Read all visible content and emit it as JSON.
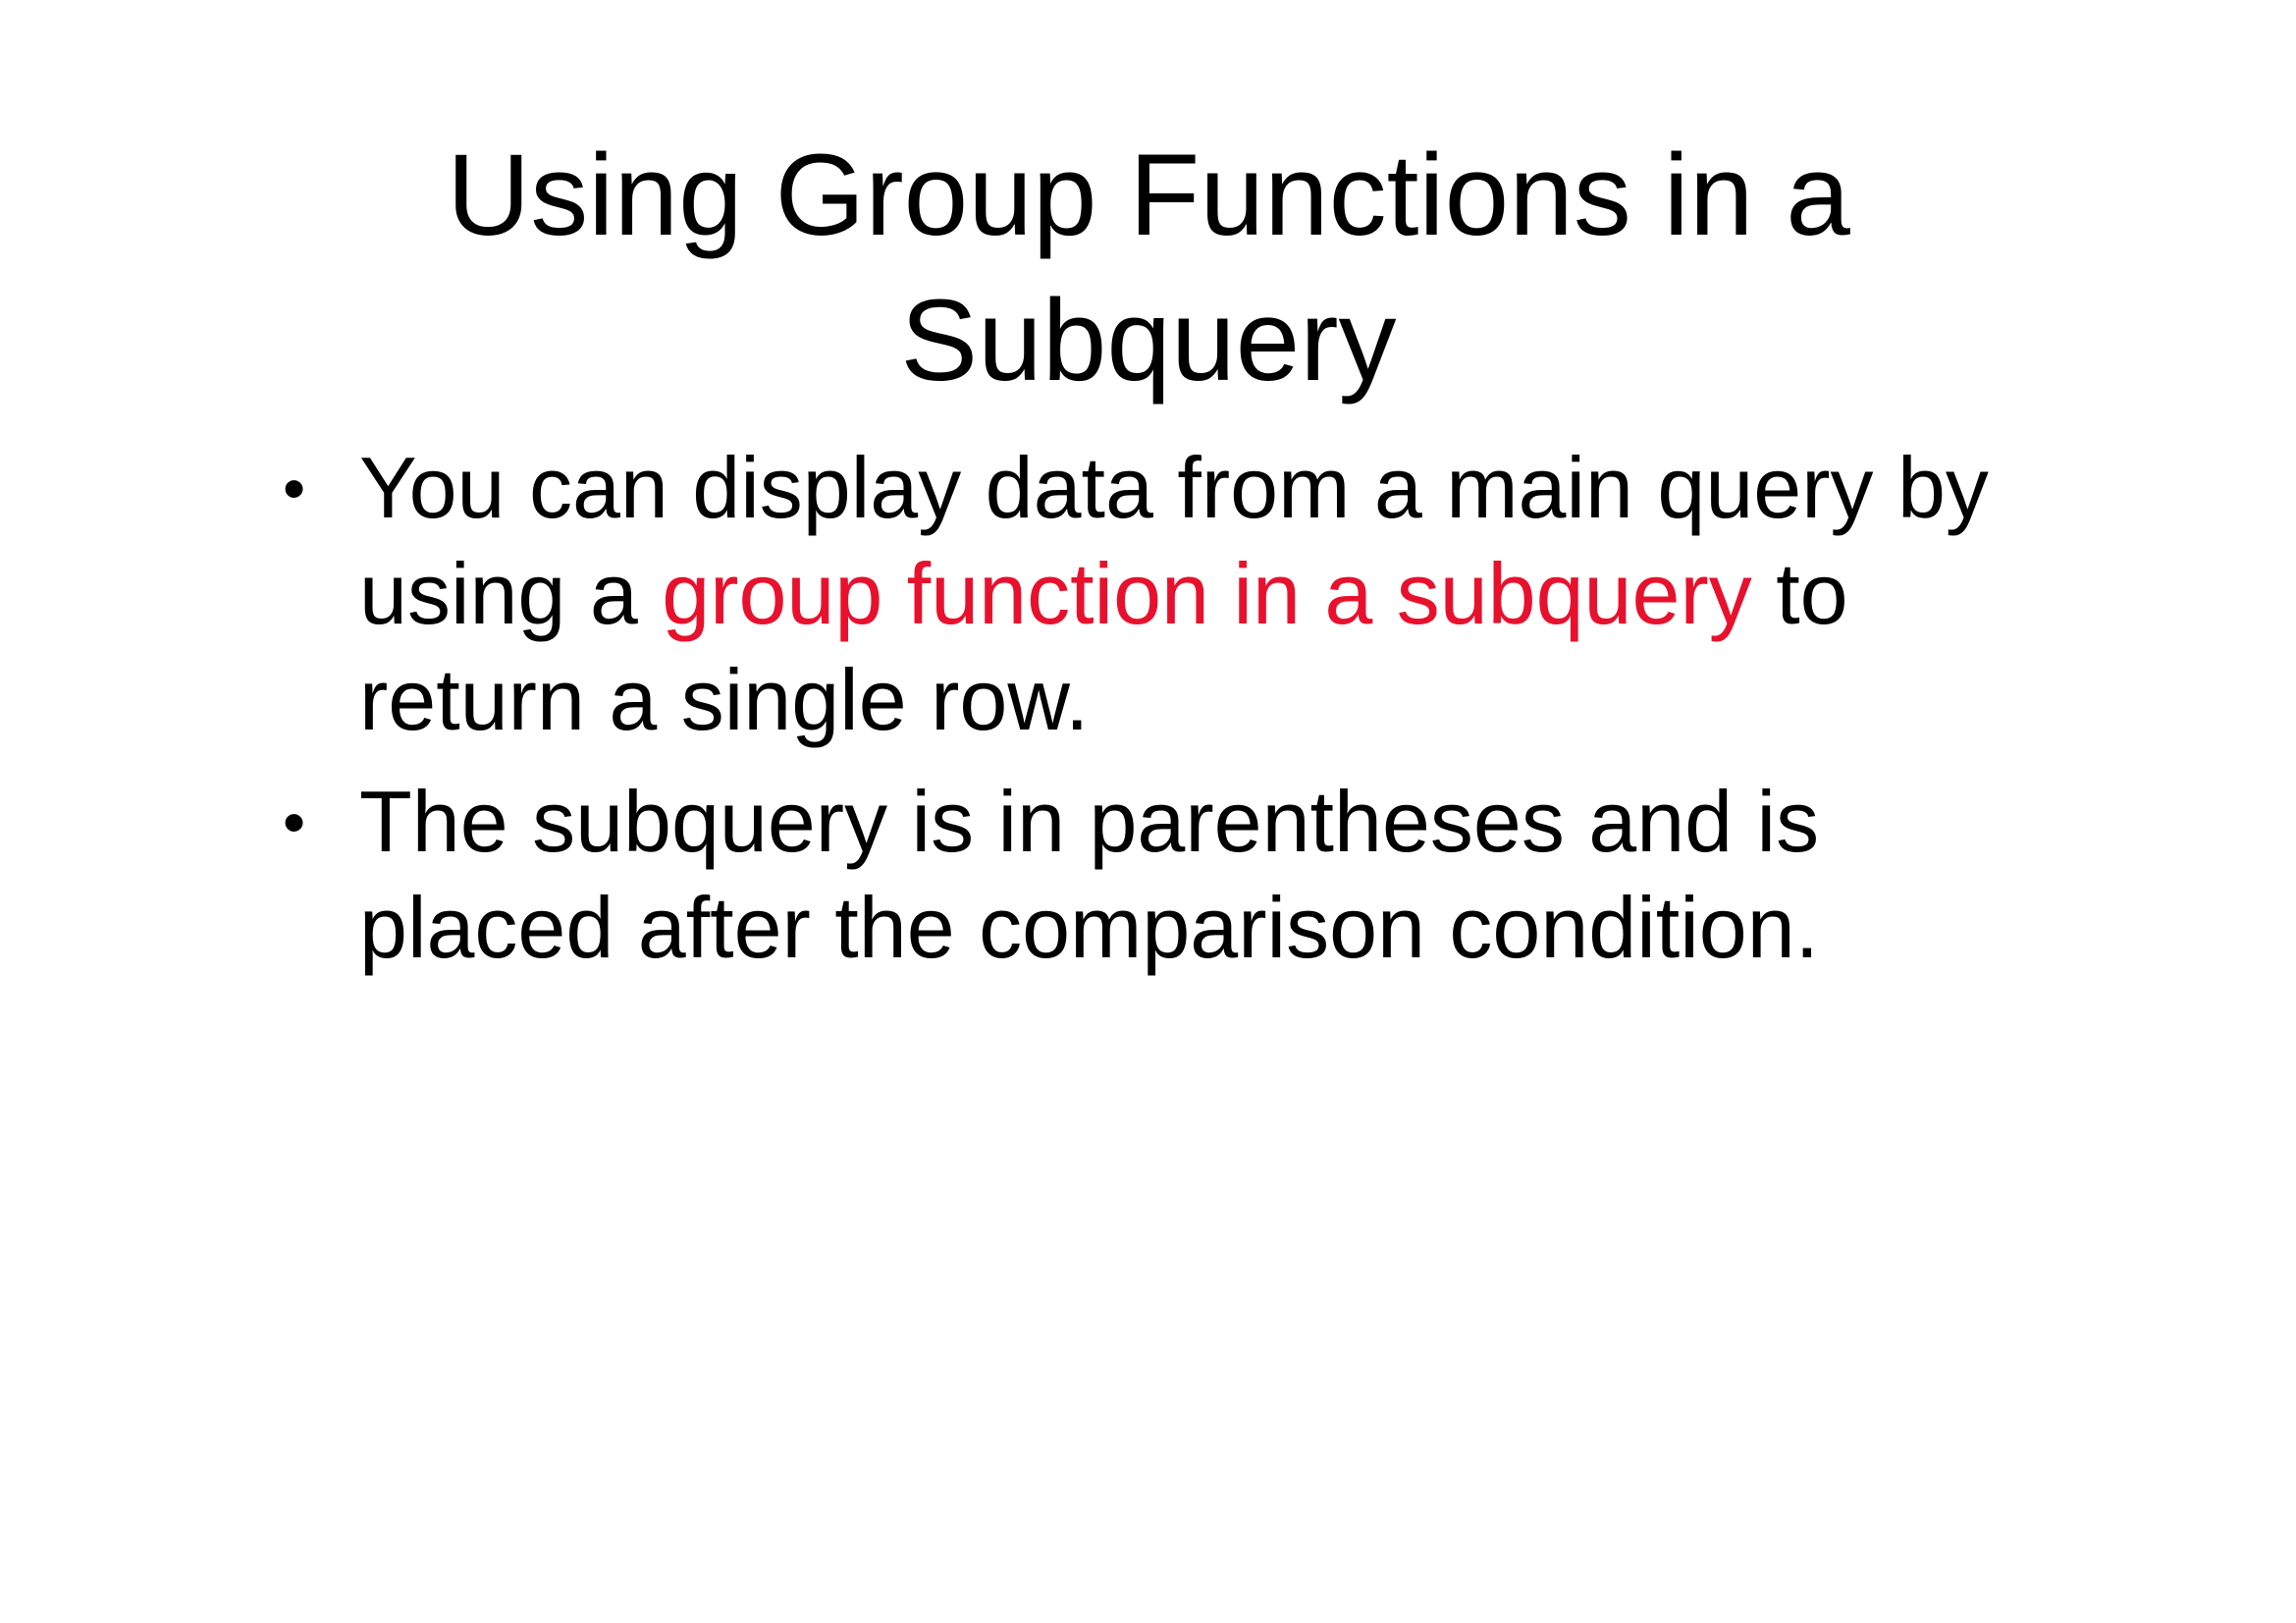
{
  "slide": {
    "title_line1": "Using Group Functions in a",
    "title_line2": "Subquery",
    "bullet_marker": "•",
    "bullets": [
      {
        "before": "You can display data from a main query by using a ",
        "highlight": "group function in a subquery",
        "after": " to return a single row."
      },
      {
        "text": "The subquery is in parentheses and is placed after the comparison condition."
      }
    ],
    "colors": {
      "text": "#000000",
      "highlight": "#e8112d",
      "background": "#ffffff"
    }
  }
}
